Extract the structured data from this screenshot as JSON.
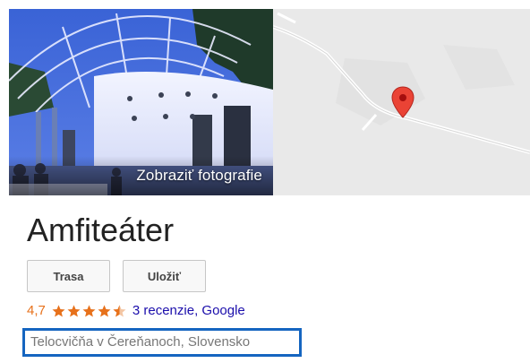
{
  "place": {
    "photo_label": "Zobraziť fotografie",
    "name": "Amfiteáter",
    "actions": {
      "directions_label": "Trasa",
      "save_label": "Uložiť"
    },
    "rating": {
      "value": "4,7",
      "stars": 4.5,
      "reviews_label": "3 recenzie, Google"
    },
    "category": "Telocvičňa v Čereňanoch, Slovensko"
  },
  "colors": {
    "rating": "#e7711b",
    "link": "#1a0dab",
    "highlight_box": "#1565c0",
    "map_pin": "#ea4335"
  },
  "icons": {
    "star": "star-icon",
    "half_star": "half-star-icon",
    "pin": "map-pin-icon"
  }
}
